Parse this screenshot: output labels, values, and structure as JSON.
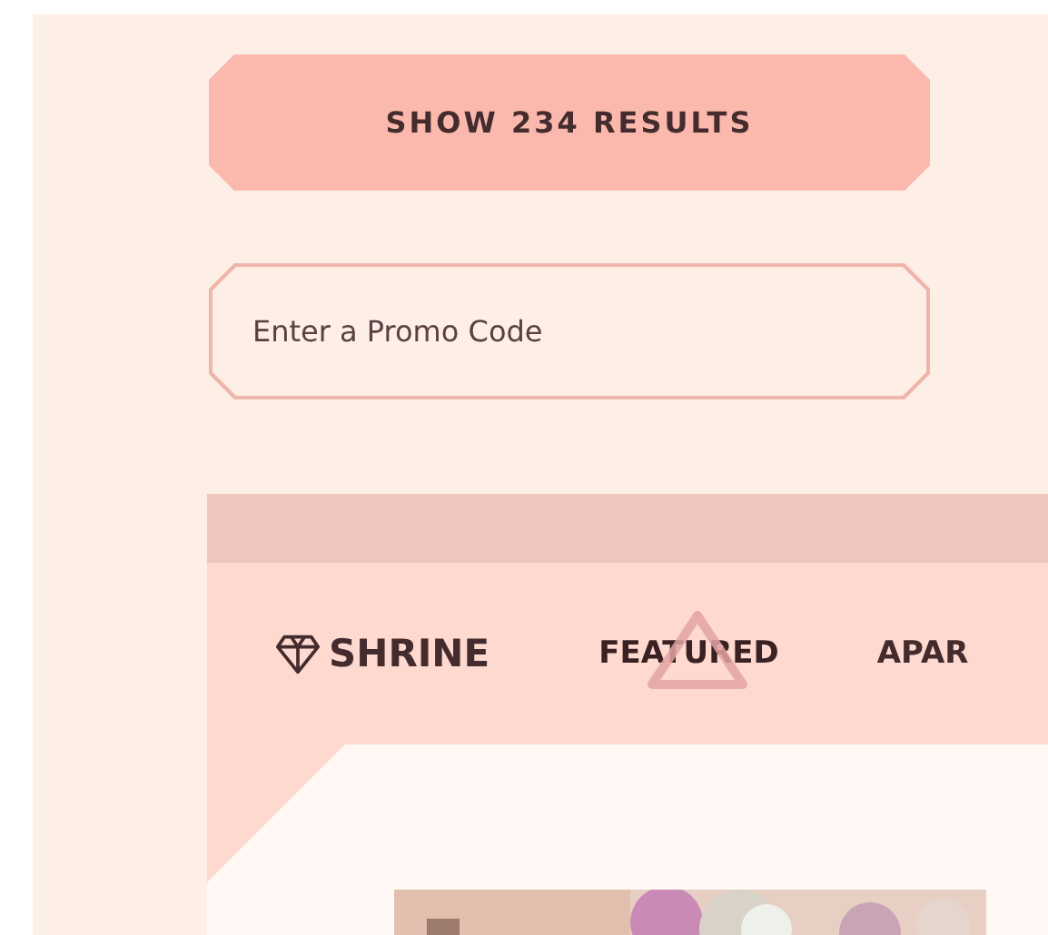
{
  "filter_button": {
    "label": "SHOW 234 RESULTS"
  },
  "promo_field": {
    "placeholder": "Enter a Promo Code"
  },
  "preview": {
    "logo": "SHRINE",
    "tabs": [
      {
        "label": "FEATURED",
        "selected": true
      },
      {
        "label": "APAR",
        "selected": false
      }
    ]
  }
}
